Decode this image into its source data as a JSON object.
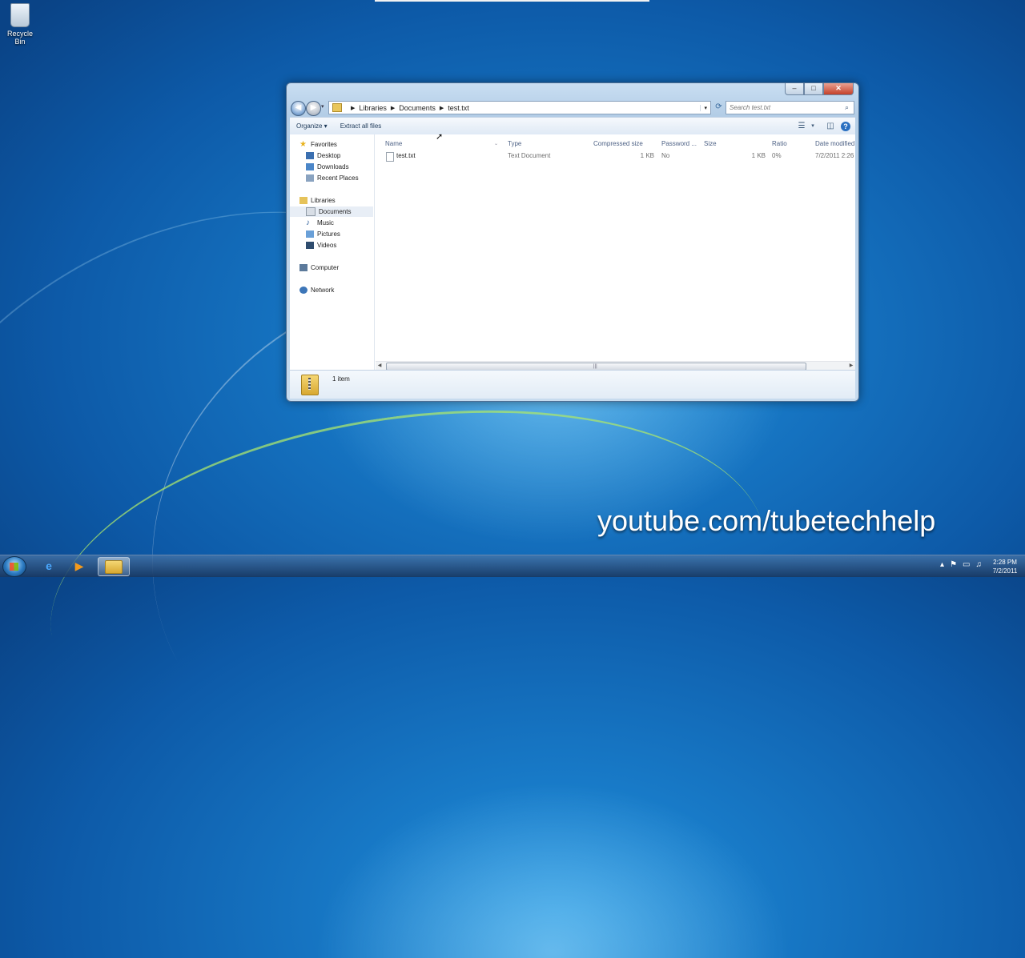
{
  "desktop": {
    "recycle_bin_label": "Recycle Bin",
    "watermark": "youtube.com/tubetechhelp"
  },
  "window": {
    "caption": {
      "minimize": "–",
      "maximize": "□",
      "close": "✕"
    },
    "address": {
      "crumbs": [
        "Libraries",
        "Documents",
        "test.txt"
      ]
    },
    "search": {
      "placeholder": "Search test.txt"
    },
    "toolbar": {
      "organize": "Organize ▾",
      "extract_all": "Extract all files"
    },
    "navpane": {
      "favorites": "Favorites",
      "desktop": "Desktop",
      "downloads": "Downloads",
      "recent_places": "Recent Places",
      "libraries": "Libraries",
      "documents": "Documents",
      "music": "Music",
      "pictures": "Pictures",
      "videos": "Videos",
      "computer": "Computer",
      "network": "Network"
    },
    "columns": {
      "name": "Name",
      "type": "Type",
      "compressed_size": "Compressed size",
      "password": "Password ...",
      "size": "Size",
      "ratio": "Ratio",
      "date_modified": "Date modified"
    },
    "files": [
      {
        "name": "test.txt",
        "type": "Text Document",
        "compressed_size": "1 KB",
        "password": "No",
        "size": "1 KB",
        "ratio": "0%",
        "date_modified": "7/2/2011 2:26 P"
      }
    ],
    "status": {
      "item_count": "1 item"
    }
  },
  "taskbar": {
    "clock_time": "2:28 PM",
    "clock_date": "7/2/2011"
  }
}
